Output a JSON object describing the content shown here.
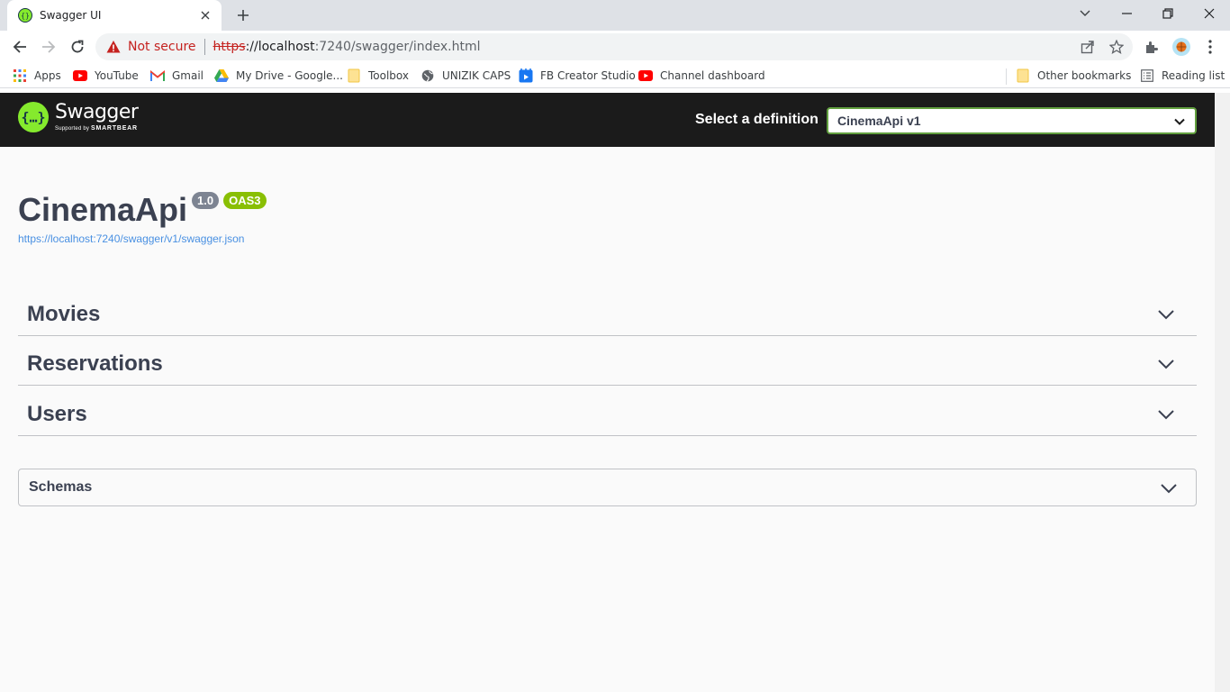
{
  "browser": {
    "tab_title": "Swagger UI",
    "not_secure": "Not secure",
    "url_scheme": "https",
    "url_host": "://localhost",
    "url_path": ":7240/swagger/index.html"
  },
  "bookmarks": {
    "items": [
      "Apps",
      "YouTube",
      "Gmail",
      "My Drive - Google...",
      "Toolbox",
      "UNIZIK CAPS",
      "FB Creator Studio",
      "Channel dashboard"
    ],
    "other": "Other bookmarks",
    "reading_list": "Reading list"
  },
  "swagger": {
    "logo_word": "Swagger",
    "logo_supported": "Supported by",
    "logo_brand": "SMARTBEAR",
    "select_label": "Select a definition",
    "selected_definition": "CinemaApi v1",
    "api_title": "CinemaApi",
    "version_badge": "1.0",
    "oas_badge": "OAS3",
    "spec_url": "https://localhost:7240/swagger/v1/swagger.json",
    "tags": [
      "Movies",
      "Reservations",
      "Users"
    ],
    "schemas_label": "Schemas"
  },
  "colors": {
    "topbar": "#1b1b1b",
    "accent_green": "#62a03f",
    "oas_badge": "#89bf04",
    "version_badge": "#7d8492",
    "link": "#4990e2",
    "text": "#3b4151"
  }
}
